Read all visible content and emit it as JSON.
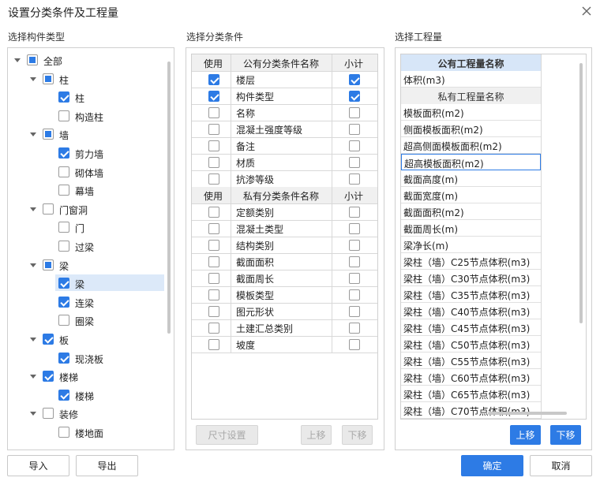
{
  "dialog": {
    "title": "设置分类条件及工程量"
  },
  "sections": {
    "component_types": "选择构件类型",
    "conditions": "选择分类条件",
    "quantities": "选择工程量"
  },
  "tree": [
    {
      "label": "全部",
      "level": 0,
      "state": "partial",
      "caret": true
    },
    {
      "label": "柱",
      "level": 1,
      "state": "partial",
      "caret": true
    },
    {
      "label": "柱",
      "level": 2,
      "state": "checked",
      "caret": false
    },
    {
      "label": "构造柱",
      "level": 2,
      "state": "unchecked",
      "caret": false
    },
    {
      "label": "墙",
      "level": 1,
      "state": "partial",
      "caret": true
    },
    {
      "label": "剪力墙",
      "level": 2,
      "state": "checked",
      "caret": false
    },
    {
      "label": "砌体墙",
      "level": 2,
      "state": "unchecked",
      "caret": false
    },
    {
      "label": "幕墙",
      "level": 2,
      "state": "unchecked",
      "caret": false
    },
    {
      "label": "门窗洞",
      "level": 1,
      "state": "unchecked",
      "caret": true
    },
    {
      "label": "门",
      "level": 2,
      "state": "unchecked",
      "caret": false
    },
    {
      "label": "过梁",
      "level": 2,
      "state": "unchecked",
      "caret": false
    },
    {
      "label": "梁",
      "level": 1,
      "state": "partial",
      "caret": true
    },
    {
      "label": "梁",
      "level": 2,
      "state": "checked",
      "caret": false,
      "selected": true
    },
    {
      "label": "连梁",
      "level": 2,
      "state": "checked",
      "caret": false
    },
    {
      "label": "圈梁",
      "level": 2,
      "state": "unchecked",
      "caret": false
    },
    {
      "label": "板",
      "level": 1,
      "state": "checked",
      "caret": true
    },
    {
      "label": "现浇板",
      "level": 2,
      "state": "checked",
      "caret": false
    },
    {
      "label": "楼梯",
      "level": 1,
      "state": "checked",
      "caret": true
    },
    {
      "label": "楼梯",
      "level": 2,
      "state": "checked",
      "caret": false
    },
    {
      "label": "装修",
      "level": 1,
      "state": "unchecked",
      "caret": true
    },
    {
      "label": "楼地面",
      "level": 2,
      "state": "unchecked",
      "caret": false
    }
  ],
  "conditions_table": {
    "public_header": {
      "use": "使用",
      "name": "公有分类条件名称",
      "subtotal": "小计"
    },
    "public_rows": [
      {
        "name": "楼层",
        "use": true,
        "subtotal": true
      },
      {
        "name": "构件类型",
        "use": true,
        "subtotal": true
      },
      {
        "name": "名称",
        "use": false,
        "subtotal": false
      },
      {
        "name": "混凝土强度等级",
        "use": false,
        "subtotal": false
      },
      {
        "name": "备注",
        "use": false,
        "subtotal": false
      },
      {
        "name": "材质",
        "use": false,
        "subtotal": false
      },
      {
        "name": "抗渗等级",
        "use": false,
        "subtotal": false
      }
    ],
    "private_header": {
      "use": "使用",
      "name": "私有分类条件名称",
      "subtotal": "小计"
    },
    "private_rows": [
      {
        "name": "定额类别",
        "use": false,
        "subtotal": false
      },
      {
        "name": "混凝土类型",
        "use": false,
        "subtotal": false
      },
      {
        "name": "结构类别",
        "use": false,
        "subtotal": false
      },
      {
        "name": "截面面积",
        "use": false,
        "subtotal": false
      },
      {
        "name": "截面周长",
        "use": false,
        "subtotal": false
      },
      {
        "name": "模板类型",
        "use": false,
        "subtotal": false
      },
      {
        "name": "图元形状",
        "use": false,
        "subtotal": false
      },
      {
        "name": "土建汇总类别",
        "use": false,
        "subtotal": false
      },
      {
        "name": "坡度",
        "use": false,
        "subtotal": false
      }
    ]
  },
  "quantities": {
    "public_header": "公有工程量名称",
    "public_rows": [
      "体积(m3)"
    ],
    "private_header": "私有工程量名称",
    "private_rows": [
      "模板面积(m2)",
      "侧面模板面积(m2)",
      "超高侧面模板面积(m2)",
      "超高模板面积(m2)",
      "截面高度(m)",
      "截面宽度(m)",
      "截面面积(m2)",
      "截面周长(m)",
      "梁净长(m)",
      "梁柱（墙）C25节点体积(m3)",
      "梁柱（墙）C30节点体积(m3)",
      "梁柱（墙）C35节点体积(m3)",
      "梁柱（墙）C40节点体积(m3)",
      "梁柱（墙）C45节点体积(m3)",
      "梁柱（墙）C50节点体积(m3)",
      "梁柱（墙）C55节点体积(m3)",
      "梁柱（墙）C60节点体积(m3)",
      "梁柱（墙）C65节点体积(m3)",
      "梁柱（墙）C70节点体积(m3)"
    ],
    "focused_index": 3
  },
  "buttons": {
    "size_settings": "尺寸设置",
    "cond_up": "上移",
    "cond_down": "下移",
    "qty_up": "上移",
    "qty_down": "下移",
    "import": "导入",
    "export": "导出",
    "ok": "确定",
    "cancel": "取消"
  },
  "colors": {
    "accent": "#2d7be5",
    "header_blue": "#d7e6f8",
    "selected_row": "#dce9f9"
  }
}
